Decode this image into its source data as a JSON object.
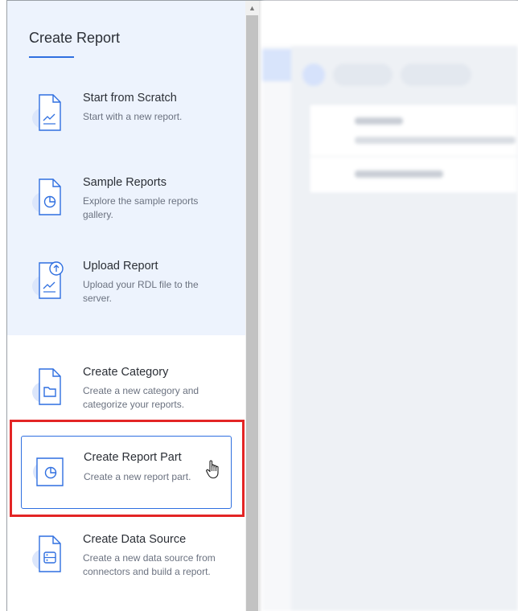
{
  "panel": {
    "title": "Create Report"
  },
  "top_items": [
    {
      "name": "Start from Scratch",
      "desc": "Start with a new report.",
      "icon": "report-chart-icon"
    },
    {
      "name": "Sample Reports",
      "desc": "Explore the sample reports gallery.",
      "icon": "report-pie-icon"
    },
    {
      "name": "Upload Report",
      "desc": "Upload your RDL file to the server.",
      "icon": "upload-report-icon"
    }
  ],
  "bottom_items": [
    {
      "name": "Create Category",
      "desc": "Create a new category and categorize your reports.",
      "icon": "folder-icon"
    },
    {
      "name": "Create Report Part",
      "desc": "Create a new report part.",
      "icon": "report-part-icon"
    },
    {
      "name": "Create Data Source",
      "desc": "Create a new data source from connectors and build a report.",
      "icon": "data-source-icon"
    }
  ],
  "colors": {
    "accent": "#2f6fe0",
    "panel_top_bg": "#edf3fd",
    "highlight": "#e32525"
  }
}
